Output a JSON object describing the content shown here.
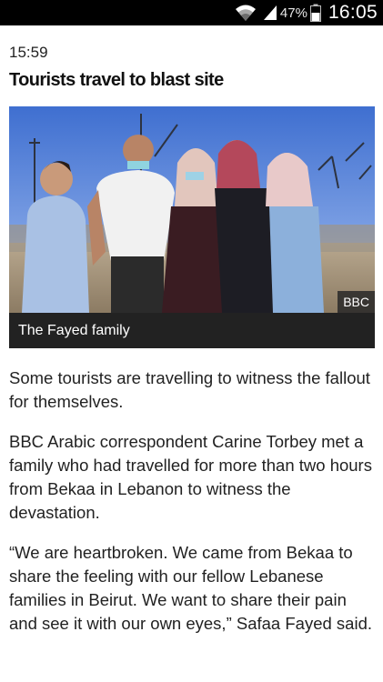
{
  "status_bar": {
    "battery_percent": "47%",
    "time": "16:05",
    "icons": [
      "wifi-icon",
      "signal-icon",
      "battery-icon"
    ]
  },
  "article": {
    "timestamp": "15:59",
    "headline": "Tourists travel to blast site",
    "image": {
      "credit": "BBC",
      "caption": "The Fayed family"
    },
    "paragraphs": [
      "Some tourists are travelling to witness the fallout for themselves.",
      "BBC Arabic correspondent Carine Torbey met a family who had travelled for more than two hours from Bekaa in Lebanon to witness the devastation.",
      "“We are heartbroken. We came from Bekaa to share the feeling with our fellow Lebanese families in Beirut. We want to share their pain and see it with our own eyes,” Safaa Fayed said."
    ]
  }
}
